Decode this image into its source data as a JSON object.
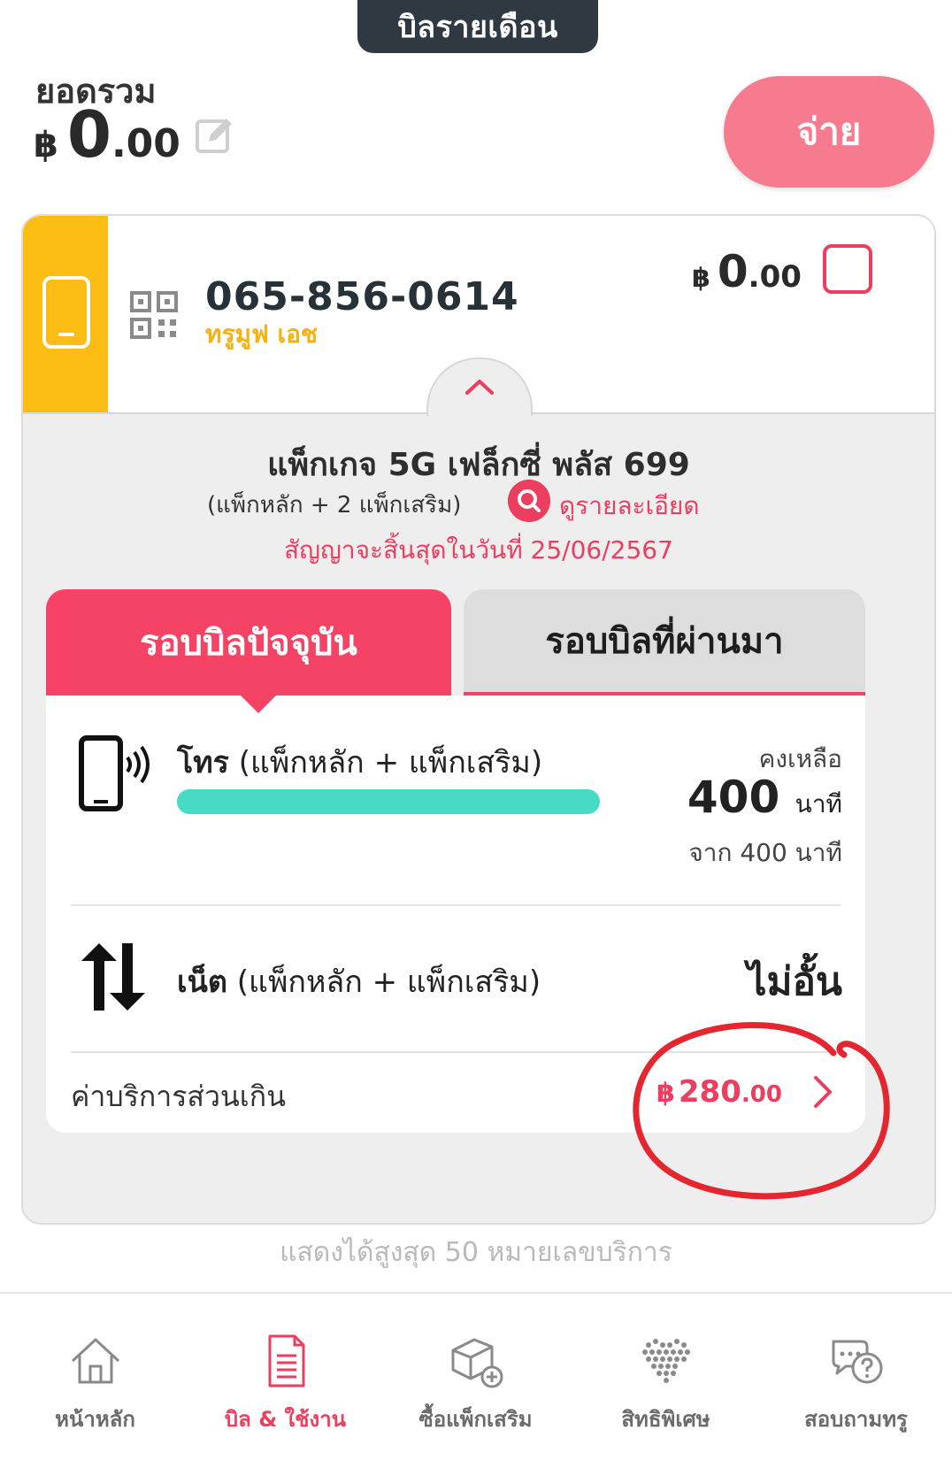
{
  "header": {
    "tab_title": "บิลรายเดือน"
  },
  "summary": {
    "total_label": "ยอดรวม",
    "currency": "฿",
    "amount_int": "0",
    "amount_dec": ".00",
    "pay_button": "จ่าย"
  },
  "account": {
    "phone_number": "065-856-0614",
    "plan": "ทรูมูฟ เอช",
    "currency": "฿",
    "amount_int": "0",
    "amount_dec": ".00",
    "package_title": "แพ็กเกจ 5G เฟล็กซี่ พลัส 699",
    "package_sub": "(แพ็กหลัก + 2 แพ็กเสริม)",
    "detail_link": "ดูรายละเอียด",
    "contract_text": "สัญญาจะสิ้นสุดในวันที่ 25/06/2567"
  },
  "tabs": {
    "current": "รอบบิลปัจจุบัน",
    "past": "รอบบิลที่ผ่านมา"
  },
  "usage": {
    "voice": {
      "title": "โทร",
      "scope": "(แพ็กหลัก + แพ็กเสริม)",
      "remaining_label": "คงเหลือ",
      "remaining_value": "400",
      "unit": "นาที",
      "from_text": "จาก 400 นาที",
      "progress": 1.0,
      "bar_color": "#47dbc6"
    },
    "data": {
      "title": "เน็ต",
      "scope": "(แพ็กหลัก + แพ็กเสริม)",
      "value": "ไม่อั้น"
    },
    "overage": {
      "label": "ค่าบริการส่วนเกิน",
      "currency": "฿",
      "amount_int": "280",
      "amount_dec": ".00"
    }
  },
  "footer_note": "แสดงได้สูงสุด 50 หมายเลขบริการ",
  "nav": {
    "items": [
      {
        "label": "หน้าหลัก",
        "icon": "home-icon"
      },
      {
        "label": "บิล & ใช้งาน",
        "icon": "bill-icon",
        "active": true
      },
      {
        "label": "ซื้อแพ็กเสริม",
        "icon": "package-add-icon"
      },
      {
        "label": "สิทธิพิเศษ",
        "icon": "heart-dots-icon"
      },
      {
        "label": "สอบถามทรู",
        "icon": "chat-question-icon"
      }
    ]
  },
  "colors": {
    "accent": "#f44364",
    "pay_button": "#f77b8e",
    "plan_yellow": "#fbbc13",
    "dark_tab": "#2f3942"
  }
}
